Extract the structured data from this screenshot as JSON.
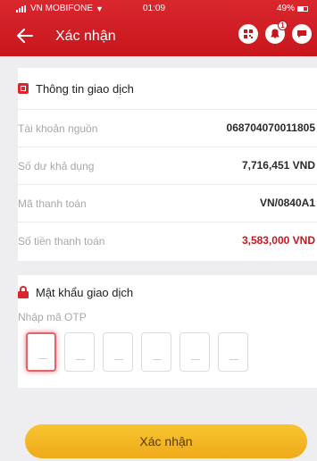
{
  "status_bar": {
    "carrier": "VN MOBIFONE",
    "time": "01:09",
    "battery": "49%"
  },
  "header": {
    "title": "Xác nhận",
    "icons": [
      "qr-icon",
      "notification-icon",
      "chat-icon"
    ],
    "notification_count": "1"
  },
  "transaction_info": {
    "title": "Thông tin giao dịch",
    "rows": [
      {
        "label": "Tài khoản nguồn",
        "value": "068704070011805"
      },
      {
        "label": "Số dư khả dụng",
        "value": "7,716,451 VND"
      },
      {
        "label": "Mã thanh toán",
        "value": "VN/0840A1"
      },
      {
        "label": "Số tiền thanh toán",
        "value": "3,583,000 VND"
      }
    ]
  },
  "otp_section": {
    "title": "Mật khẩu giao dịch",
    "label": "Nhập mã OTP",
    "digits": [
      "",
      "",
      "",
      "",
      "",
      ""
    ]
  },
  "confirm_button": "Xác nhận",
  "colors": {
    "brand_red": "#c8161d",
    "amount_red": "#c8161d",
    "button_yellow": "#f4b823"
  }
}
